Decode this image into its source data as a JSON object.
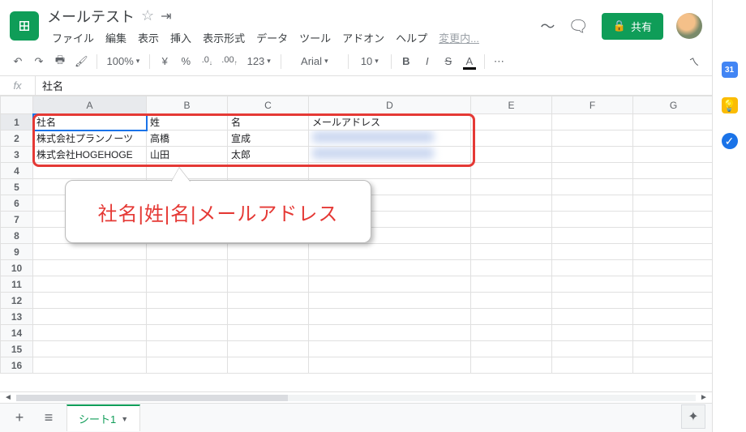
{
  "header": {
    "doc_title": "メールテスト",
    "menus": [
      "ファイル",
      "編集",
      "表示",
      "挿入",
      "表示形式",
      "データ",
      "ツール",
      "アドオン",
      "ヘルプ"
    ],
    "last_edit_hint": "変更内...",
    "share_label": "共有"
  },
  "toolbar": {
    "zoom": "100%",
    "currency": "¥",
    "percent": "%",
    "dec_dec": ".0",
    "dec_inc": ".00",
    "num_format": "123",
    "font": "Arial",
    "font_size": "10",
    "bold": "B",
    "italic": "I",
    "strike": "S",
    "text_color": "A"
  },
  "formula_bar": {
    "fx": "fx",
    "value": "社名"
  },
  "columns": [
    "A",
    "B",
    "C",
    "D",
    "E",
    "F",
    "G"
  ],
  "row_numbers": [
    1,
    2,
    3,
    4,
    5,
    6,
    7,
    8,
    9,
    10,
    11,
    12,
    13,
    14,
    15,
    16
  ],
  "chart_data": {
    "type": "table",
    "headers": [
      "社名",
      "姓",
      "名",
      "メールアドレス"
    ],
    "rows": [
      [
        "株式会社プランノーツ",
        "高橋",
        "宣成",
        ""
      ],
      [
        "株式会社HOGEHOGE",
        "山田",
        "太郎",
        ""
      ]
    ]
  },
  "annotation": {
    "callout_text": "社名|姓|名|メールアドレス"
  },
  "sheet_tabs": {
    "active": "シート1"
  },
  "side_panel": {
    "calendar": "31"
  }
}
